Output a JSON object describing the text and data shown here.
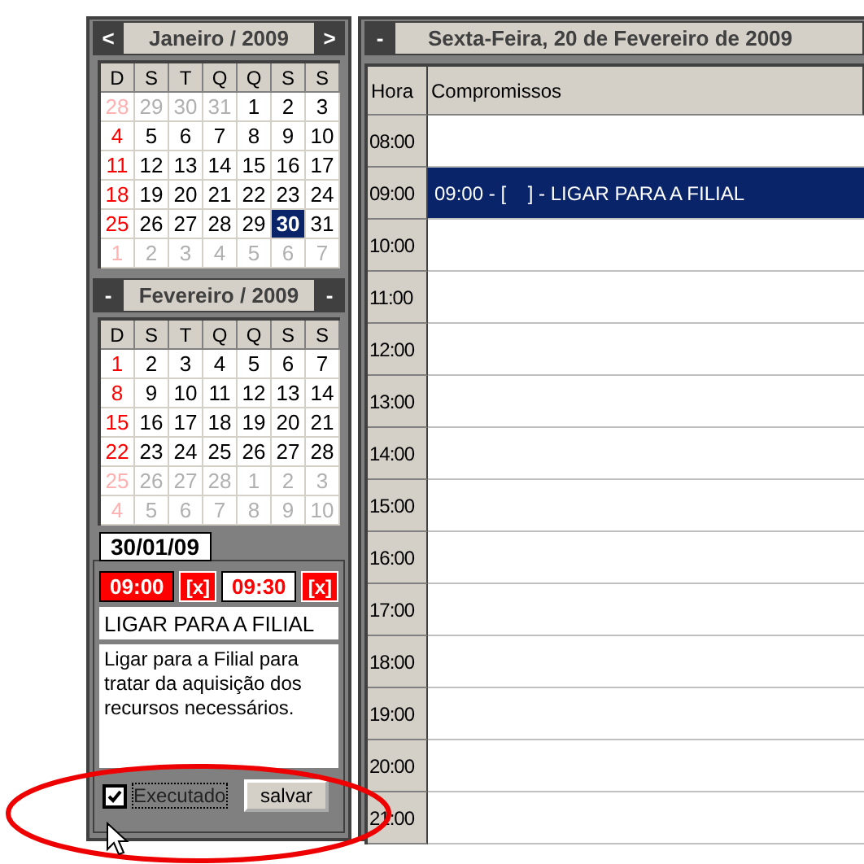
{
  "calendars": [
    {
      "prev": "<",
      "next": ">",
      "title": "Janeiro / 2009",
      "weekdays": [
        "D",
        "S",
        "T",
        "Q",
        "Q",
        "S",
        "S"
      ],
      "weeks": [
        [
          {
            "day": "28",
            "muted": true,
            "selected": false
          },
          {
            "day": "29",
            "muted": true,
            "selected": false
          },
          {
            "day": "30",
            "muted": true,
            "selected": false
          },
          {
            "day": "31",
            "muted": true,
            "selected": false
          },
          {
            "day": "1",
            "muted": false,
            "selected": false
          },
          {
            "day": "2",
            "muted": false,
            "selected": false
          },
          {
            "day": "3",
            "muted": false,
            "selected": false
          }
        ],
        [
          {
            "day": "4",
            "muted": false,
            "selected": false
          },
          {
            "day": "5",
            "muted": false,
            "selected": false
          },
          {
            "day": "6",
            "muted": false,
            "selected": false
          },
          {
            "day": "7",
            "muted": false,
            "selected": false
          },
          {
            "day": "8",
            "muted": false,
            "selected": false
          },
          {
            "day": "9",
            "muted": false,
            "selected": false
          },
          {
            "day": "10",
            "muted": false,
            "selected": false
          }
        ],
        [
          {
            "day": "11",
            "muted": false,
            "selected": false
          },
          {
            "day": "12",
            "muted": false,
            "selected": false
          },
          {
            "day": "13",
            "muted": false,
            "selected": false
          },
          {
            "day": "14",
            "muted": false,
            "selected": false
          },
          {
            "day": "15",
            "muted": false,
            "selected": false
          },
          {
            "day": "16",
            "muted": false,
            "selected": false
          },
          {
            "day": "17",
            "muted": false,
            "selected": false
          }
        ],
        [
          {
            "day": "18",
            "muted": false,
            "selected": false
          },
          {
            "day": "19",
            "muted": false,
            "selected": false
          },
          {
            "day": "20",
            "muted": false,
            "selected": false
          },
          {
            "day": "21",
            "muted": false,
            "selected": false
          },
          {
            "day": "22",
            "muted": false,
            "selected": false
          },
          {
            "day": "23",
            "muted": false,
            "selected": false
          },
          {
            "day": "24",
            "muted": false,
            "selected": false
          }
        ],
        [
          {
            "day": "25",
            "muted": false,
            "selected": false
          },
          {
            "day": "26",
            "muted": false,
            "selected": false
          },
          {
            "day": "27",
            "muted": false,
            "selected": false
          },
          {
            "day": "28",
            "muted": false,
            "selected": false
          },
          {
            "day": "29",
            "muted": false,
            "selected": false
          },
          {
            "day": "30",
            "muted": false,
            "selected": true
          },
          {
            "day": "31",
            "muted": false,
            "selected": false
          }
        ],
        [
          {
            "day": "1",
            "muted": true,
            "selected": false
          },
          {
            "day": "2",
            "muted": true,
            "selected": false
          },
          {
            "day": "3",
            "muted": true,
            "selected": false
          },
          {
            "day": "4",
            "muted": true,
            "selected": false
          },
          {
            "day": "5",
            "muted": true,
            "selected": false
          },
          {
            "day": "6",
            "muted": true,
            "selected": false
          },
          {
            "day": "7",
            "muted": true,
            "selected": false
          }
        ]
      ]
    },
    {
      "prev": "-",
      "next": "-",
      "title": "Fevereiro / 2009",
      "weekdays": [
        "D",
        "S",
        "T",
        "Q",
        "Q",
        "S",
        "S"
      ],
      "weeks": [
        [
          {
            "day": "1",
            "muted": false,
            "selected": false
          },
          {
            "day": "2",
            "muted": false,
            "selected": false
          },
          {
            "day": "3",
            "muted": false,
            "selected": false
          },
          {
            "day": "4",
            "muted": false,
            "selected": false
          },
          {
            "day": "5",
            "muted": false,
            "selected": false
          },
          {
            "day": "6",
            "muted": false,
            "selected": false
          },
          {
            "day": "7",
            "muted": false,
            "selected": false
          }
        ],
        [
          {
            "day": "8",
            "muted": false,
            "selected": false
          },
          {
            "day": "9",
            "muted": false,
            "selected": false
          },
          {
            "day": "10",
            "muted": false,
            "selected": false
          },
          {
            "day": "11",
            "muted": false,
            "selected": false
          },
          {
            "day": "12",
            "muted": false,
            "selected": false
          },
          {
            "day": "13",
            "muted": false,
            "selected": false
          },
          {
            "day": "14",
            "muted": false,
            "selected": false
          }
        ],
        [
          {
            "day": "15",
            "muted": false,
            "selected": false
          },
          {
            "day": "16",
            "muted": false,
            "selected": false
          },
          {
            "day": "17",
            "muted": false,
            "selected": false
          },
          {
            "day": "18",
            "muted": false,
            "selected": false
          },
          {
            "day": "19",
            "muted": false,
            "selected": false
          },
          {
            "day": "20",
            "muted": false,
            "selected": false
          },
          {
            "day": "21",
            "muted": false,
            "selected": false
          }
        ],
        [
          {
            "day": "22",
            "muted": false,
            "selected": false
          },
          {
            "day": "23",
            "muted": false,
            "selected": false
          },
          {
            "day": "24",
            "muted": false,
            "selected": false
          },
          {
            "day": "25",
            "muted": false,
            "selected": false
          },
          {
            "day": "26",
            "muted": false,
            "selected": false
          },
          {
            "day": "27",
            "muted": false,
            "selected": false
          },
          {
            "day": "28",
            "muted": false,
            "selected": false
          }
        ],
        [
          {
            "day": "25",
            "muted": true,
            "selected": false
          },
          {
            "day": "26",
            "muted": true,
            "selected": false
          },
          {
            "day": "27",
            "muted": true,
            "selected": false
          },
          {
            "day": "28",
            "muted": true,
            "selected": false
          },
          {
            "day": "1",
            "muted": true,
            "selected": false
          },
          {
            "day": "2",
            "muted": true,
            "selected": false
          },
          {
            "day": "3",
            "muted": true,
            "selected": false
          }
        ],
        [
          {
            "day": "4",
            "muted": true,
            "selected": false
          },
          {
            "day": "5",
            "muted": true,
            "selected": false
          },
          {
            "day": "6",
            "muted": true,
            "selected": false
          },
          {
            "day": "7",
            "muted": true,
            "selected": false
          },
          {
            "day": "8",
            "muted": true,
            "selected": false
          },
          {
            "day": "9",
            "muted": true,
            "selected": false
          },
          {
            "day": "10",
            "muted": true,
            "selected": false
          }
        ]
      ]
    }
  ],
  "detail": {
    "date": "30/01/09",
    "start": "09:00",
    "start_clear": "[x]",
    "end": "09:30",
    "end_clear": "[x]",
    "title": "LIGAR PARA A FILIAL",
    "description": "Ligar para a Filial para tratar da aquisição dos recursos necessários.",
    "done_label": "Executado",
    "done": true,
    "save": "salvar"
  },
  "schedule": {
    "collapse": "-",
    "title": "Sexta-Feira, 20 de Fevereiro de 2009",
    "columns": [
      "Hora",
      "Compromissos"
    ],
    "rows": [
      {
        "hour": "08:00",
        "entry": "",
        "selected": false
      },
      {
        "hour": "09:00",
        "entry": "09:00 - [    ] - LIGAR PARA A FILIAL",
        "selected": true
      },
      {
        "hour": "10:00",
        "entry": "",
        "selected": false
      },
      {
        "hour": "11:00",
        "entry": "",
        "selected": false
      },
      {
        "hour": "12:00",
        "entry": "",
        "selected": false
      },
      {
        "hour": "13:00",
        "entry": "",
        "selected": false
      },
      {
        "hour": "14:00",
        "entry": "",
        "selected": false
      },
      {
        "hour": "15:00",
        "entry": "",
        "selected": false
      },
      {
        "hour": "16:00",
        "entry": "",
        "selected": false
      },
      {
        "hour": "17:00",
        "entry": "",
        "selected": false
      },
      {
        "hour": "18:00",
        "entry": "",
        "selected": false
      },
      {
        "hour": "19:00",
        "entry": "",
        "selected": false
      },
      {
        "hour": "20:00",
        "entry": "",
        "selected": false
      },
      {
        "hour": "21:00",
        "entry": "",
        "selected": false
      }
    ]
  }
}
